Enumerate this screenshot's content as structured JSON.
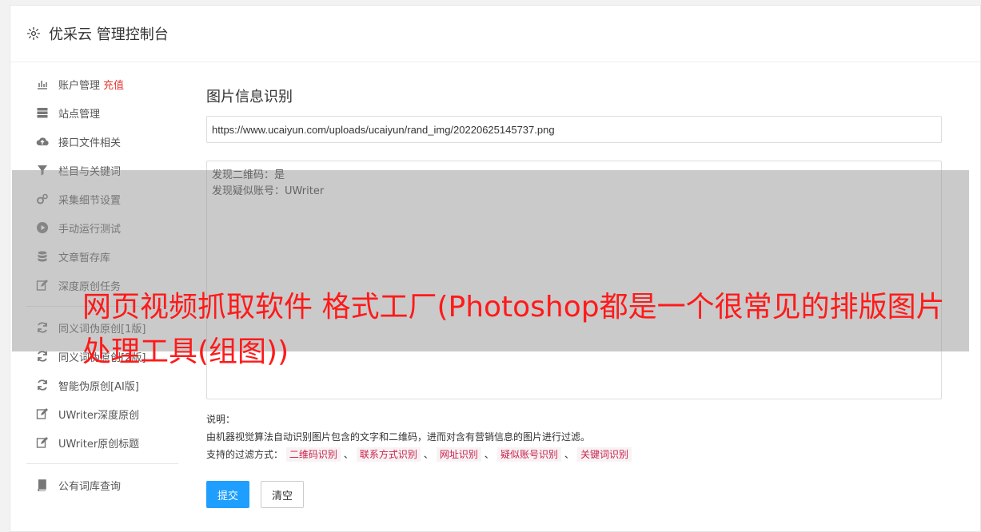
{
  "header": {
    "title": "优采云 管理控制台",
    "icon": "gear-icon"
  },
  "sidebar": {
    "items": [
      {
        "label": "账户管理",
        "extra": "充值",
        "icon": "bar-chart-icon"
      },
      {
        "label": "站点管理",
        "icon": "server-icon"
      },
      {
        "label": "接口文件相关",
        "icon": "cloud-upload-icon"
      },
      {
        "label": "栏目与关键词",
        "icon": "filter-icon"
      },
      {
        "label": "采集细节设置",
        "icon": "gears-icon"
      },
      {
        "label": "手动运行测试",
        "icon": "play-icon"
      },
      {
        "label": "文章暂存库",
        "icon": "database-icon"
      },
      {
        "label": "深度原创任务",
        "icon": "edit-icon"
      }
    ],
    "items2": [
      {
        "label": "同义词伪原创[1版]",
        "icon": "refresh-icon"
      },
      {
        "label": "同义词伪原创[2版]",
        "icon": "refresh-icon"
      },
      {
        "label": "智能伪原创[AI版]",
        "icon": "refresh-icon"
      },
      {
        "label": "UWriter深度原创",
        "icon": "edit-icon"
      },
      {
        "label": "UWriter原创标题",
        "icon": "edit-icon"
      }
    ],
    "items3": [
      {
        "label": "公有词库查询",
        "icon": "book-icon"
      }
    ]
  },
  "main": {
    "title": "图片信息识别",
    "url_value": "https://www.ucaiyun.com/uploads/ucaiyun/rand_img/20220625145737.png",
    "result_lines": [
      "发现二维码：是",
      "发现疑似账号：UWriter"
    ],
    "desc_label": "说明：",
    "desc_text": "由机器视觉算法自动识别图片包含的文字和二维码，进而对含有营销信息的图片进行过滤。",
    "filter_label": "支持的过滤方式：",
    "filters": [
      "二维码识别",
      "联系方式识别",
      "网址识别",
      "疑似账号识别",
      "关键词识别"
    ],
    "filter_sep": "、",
    "submit_label": "提交",
    "clear_label": "清空"
  },
  "watermark": {
    "text": "网页视频抓取软件 格式工厂(Photoshop都是一个很常见的排版图片处理工具(组图))",
    "color": "#ff1a1a"
  }
}
